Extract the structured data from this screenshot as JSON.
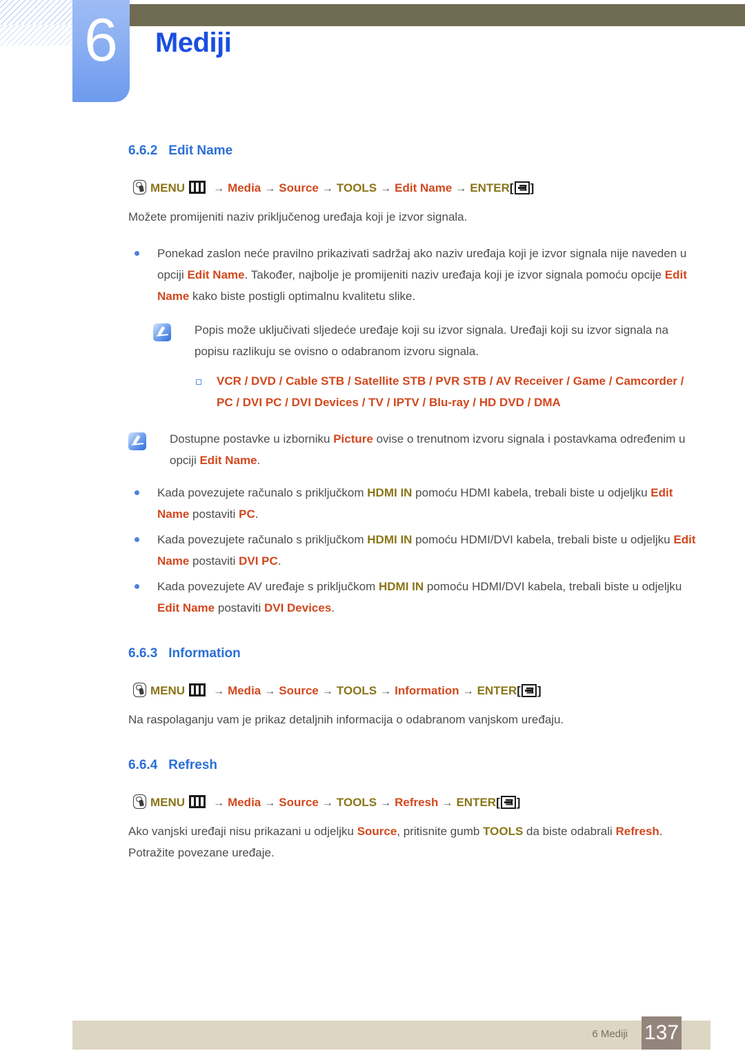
{
  "header": {
    "chapter_number": "6",
    "chapter_title": "Mediji",
    "accent_blue": "#1a4fe0",
    "tab_blue": "#7aa3f0",
    "olive_bar": "#6f6a52"
  },
  "icons": {
    "hand": "hand-press-icon",
    "menu_grid": "menu-grid-icon",
    "enter_return": "enter-return-icon",
    "note": "note-pencil-icon"
  },
  "colors": {
    "highlight_red": "#d2481e",
    "highlight_olive": "#8a7519",
    "heading_blue": "#2b6fd6",
    "bullet_blue": "#4f7fe0",
    "footer_bar": "#ddd6c4",
    "page_box": "#93857c"
  },
  "sections": [
    {
      "number": "6.6.2",
      "title": "Edit Name",
      "menu_path": {
        "menu_label": "MENU",
        "steps": [
          "Media",
          "Source",
          "TOOLS",
          "Edit Name"
        ],
        "enter_label": "ENTER",
        "arrow": "→"
      },
      "intro": "Možete promijeniti naziv priključenog uređaja koji je izvor signala.",
      "bullets": [
        {
          "parts": [
            {
              "t": "Ponekad zaslon neće pravilno prikazivati sadržaj ako naziv uređaja koji je izvor signala nije naveden u opciji ",
              "s": "n"
            },
            {
              "t": "Edit Name",
              "s": "red"
            },
            {
              "t": ". Također, najbolje je promijeniti naziv uređaja koji je izvor signala pomoću opcije ",
              "s": "n"
            },
            {
              "t": "Edit Name",
              "s": "red"
            },
            {
              "t": " kako biste postigli optimalnu kvalitetu slike.",
              "s": "n"
            }
          ]
        }
      ],
      "note_a": {
        "text": "Popis može uključivati sljedeće uređaje koji su izvor signala. Uređaji koji su izvor signala na popisu razlikuju se ovisno o odabranom izvoru signala.",
        "device_list_line1": "VCR / DVD / Cable STB / Satellite STB / PVR STB / AV Receiver / Game / Camcorder /",
        "device_list_line2": "PC / DVI PC / DVI Devices / TV / IPTV / Blu-ray / HD DVD / DMA",
        "devices": [
          "VCR",
          "DVD",
          "Cable STB",
          "Satellite STB",
          "PVR STB",
          "AV Receiver",
          "Game",
          "Camcorder",
          "PC",
          "DVI PC",
          "DVI Devices",
          "TV",
          "IPTV",
          "Blu-ray",
          "HD DVD",
          "DMA"
        ]
      },
      "note_b": {
        "parts": [
          {
            "t": "Dostupne postavke u izborniku ",
            "s": "n"
          },
          {
            "t": "Picture",
            "s": "red"
          },
          {
            "t": " ovise o trenutnom izvoru signala i postavkama određenim u opciji ",
            "s": "n"
          },
          {
            "t": "Edit Name",
            "s": "red"
          },
          {
            "t": ".",
            "s": "n"
          }
        ]
      },
      "bullets2": [
        {
          "parts": [
            {
              "t": "Kada povezujete računalo s priključkom ",
              "s": "n"
            },
            {
              "t": "HDMI IN",
              "s": "olive"
            },
            {
              "t": " pomoću HDMI kabela, trebali biste u odjeljku ",
              "s": "n"
            },
            {
              "t": "Edit Name",
              "s": "red"
            },
            {
              "t": " postaviti ",
              "s": "n"
            },
            {
              "t": "PC",
              "s": "red"
            },
            {
              "t": ".",
              "s": "n"
            }
          ]
        },
        {
          "parts": [
            {
              "t": "Kada povezujete računalo s priključkom ",
              "s": "n"
            },
            {
              "t": "HDMI IN",
              "s": "olive"
            },
            {
              "t": " pomoću HDMI/DVI kabela, trebali biste u odjeljku ",
              "s": "n"
            },
            {
              "t": "Edit Name",
              "s": "red"
            },
            {
              "t": " postaviti ",
              "s": "n"
            },
            {
              "t": "DVI PC",
              "s": "red"
            },
            {
              "t": ".",
              "s": "n"
            }
          ]
        },
        {
          "parts": [
            {
              "t": "Kada povezujete AV uređaje s priključkom ",
              "s": "n"
            },
            {
              "t": "HDMI IN",
              "s": "olive"
            },
            {
              "t": " pomoću HDMI/DVI kabela, trebali biste u odjeljku ",
              "s": "n"
            },
            {
              "t": "Edit Name",
              "s": "red"
            },
            {
              "t": " postaviti ",
              "s": "n"
            },
            {
              "t": "DVI Devices",
              "s": "red"
            },
            {
              "t": ".",
              "s": "n"
            }
          ]
        }
      ]
    },
    {
      "number": "6.6.3",
      "title": "Information",
      "menu_path": {
        "menu_label": "MENU",
        "steps": [
          "Media",
          "Source",
          "TOOLS",
          "Information"
        ],
        "enter_label": "ENTER",
        "arrow": "→"
      },
      "intro": "Na raspolaganju vam je prikaz detaljnih informacija o odabranom vanjskom uređaju."
    },
    {
      "number": "6.6.4",
      "title": "Refresh",
      "menu_path": {
        "menu_label": "MENU",
        "steps": [
          "Media",
          "Source",
          "TOOLS",
          "Refresh"
        ],
        "enter_label": "ENTER",
        "arrow": "→"
      },
      "intro_parts": [
        {
          "t": "Ako vanjski uređaji nisu prikazani u odjeljku ",
          "s": "n"
        },
        {
          "t": "Source",
          "s": "red"
        },
        {
          "t": ", pritisnite gumb ",
          "s": "n"
        },
        {
          "t": "TOOLS",
          "s": "olive"
        },
        {
          "t": " da biste odabrali ",
          "s": "n"
        },
        {
          "t": "Refresh",
          "s": "red"
        },
        {
          "t": ".",
          "s": "n"
        }
      ],
      "intro_line2": "Potražite povezane uređaje."
    }
  ],
  "footer": {
    "label": "6 Mediji",
    "page_number": "137"
  }
}
